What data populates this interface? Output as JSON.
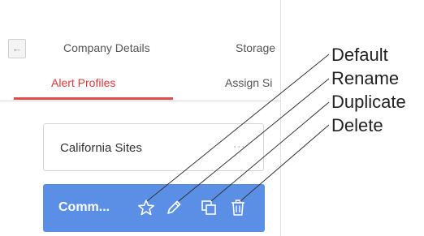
{
  "tabs_row1": {
    "back_icon": "arrow-left-icon",
    "tabs": [
      {
        "label": "Company Details"
      },
      {
        "label": "Storage"
      }
    ]
  },
  "tabs_row2": {
    "tabs": [
      {
        "label": "Alert Profiles",
        "active": true
      },
      {
        "label": "Assign Si"
      }
    ]
  },
  "profiles": [
    {
      "name": "California Sites",
      "menu": "..."
    },
    {
      "name": "Comm...",
      "selected": true
    }
  ],
  "actions": [
    {
      "icon": "star-icon",
      "callout": "Default"
    },
    {
      "icon": "pencil-icon",
      "callout": "Rename"
    },
    {
      "icon": "duplicate-icon",
      "callout": "Duplicate"
    },
    {
      "icon": "trash-icon",
      "callout": "Delete"
    }
  ],
  "colors": {
    "accent_red": "#e54848",
    "selected_card": "#5b8fe6"
  }
}
